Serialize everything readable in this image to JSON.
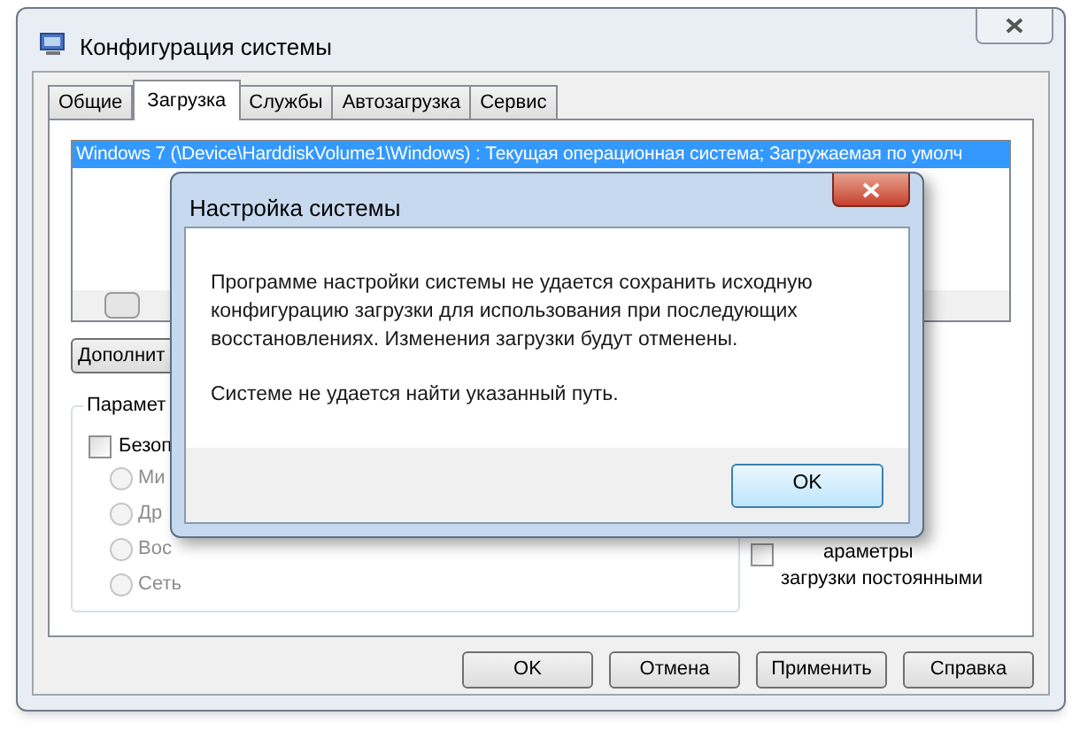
{
  "window": {
    "title": "Конфигурация системы"
  },
  "tabs": [
    {
      "label": "Общие",
      "selected": false
    },
    {
      "label": "Загрузка",
      "selected": true
    },
    {
      "label": "Службы",
      "selected": false
    },
    {
      "label": "Автозагрузка",
      "selected": false
    },
    {
      "label": "Сервис",
      "selected": false
    }
  ],
  "boot_list": {
    "rows": [
      {
        "text": "Windows 7 (\\Device\\HarddiskVolume1\\Windows) : Текущая операционная система; Загружаемая по умолч",
        "selected": true
      }
    ]
  },
  "advanced_button": "Дополнит",
  "boot_options": {
    "title": "Парамет",
    "safe_boot": {
      "label": "Безоп",
      "checked": false
    },
    "modes": [
      {
        "label": "Ми",
        "selected": false,
        "disabled": true
      },
      {
        "label": "Др",
        "selected": false,
        "disabled": true
      },
      {
        "label": "Вос",
        "selected": false,
        "disabled": true
      },
      {
        "label": "Сеть",
        "selected": false,
        "disabled": true
      }
    ]
  },
  "make_permanent": {
    "lines": [
      "араметры",
      "загрузки постоянными"
    ],
    "checked": false
  },
  "buttons": [
    "OK",
    "Отмена",
    "Применить",
    "Справка"
  ],
  "dialog": {
    "title": "Настройка системы",
    "message": "Программе настройки системы не удается сохранить исходную конфигурацию загрузки для использования при последующих восстановлениях. Изменения загрузки будут отменены.",
    "detail": "Системе не удается найти указанный путь.",
    "button": "OK"
  }
}
